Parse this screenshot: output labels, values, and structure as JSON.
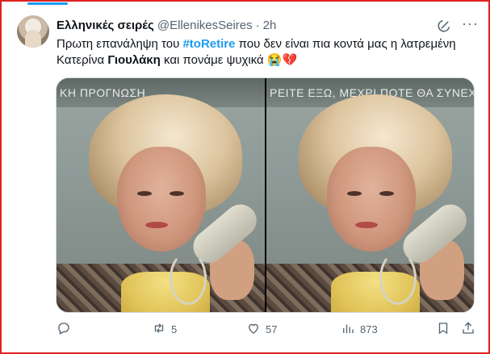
{
  "post": {
    "author_name": "Ελληνικές σειρές",
    "handle": "@EllenikesSeires",
    "separator": "·",
    "time": "2h",
    "text_part1": "Πρωτη επανάληψη του ",
    "hashtag": "#toRetire",
    "text_part2": " που δεν είναι πια κοντά μας η λατρεμένη Κατερίνα ",
    "bold_name": "Γιουλάκη",
    "text_part3": " και πονάμε ψυχικά 😭💔"
  },
  "media": {
    "left_caption": "ΚΗ ΠΡΟΓΝΩΣΗ",
    "right_caption": "ΡΕΙΤΕ ΕΞΩ, ΜΕΧΡΙ ΠΟΤΕ ΘΑ ΣΥΝΕΧΙΖ"
  },
  "actions": {
    "reply_icon": "reply-icon",
    "retweet_icon": "retweet-icon",
    "retweet_count": "5",
    "like_icon": "heart-icon",
    "like_count": "57",
    "views_icon": "views-icon",
    "views_count": "873",
    "bookmark_icon": "bookmark-icon",
    "share_icon": "share-icon"
  },
  "colors": {
    "accent": "#1d9bf0",
    "muted": "#536471",
    "frame": "#e02020"
  }
}
